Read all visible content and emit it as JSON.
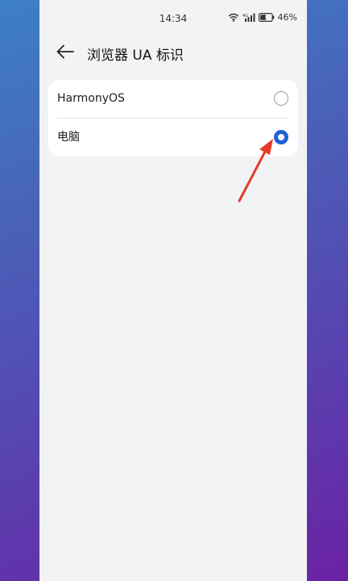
{
  "status_bar": {
    "time": "14:34",
    "battery": "46%"
  },
  "header": {
    "title": "浏览器 UA 标识",
    "back_icon": "arrow-left-icon"
  },
  "options": [
    {
      "label": "HarmonyOS",
      "selected": false
    },
    {
      "label": "电脑",
      "selected": true
    }
  ],
  "colors": {
    "accent": "#1f62d6",
    "annotation": "#e53b2c"
  }
}
